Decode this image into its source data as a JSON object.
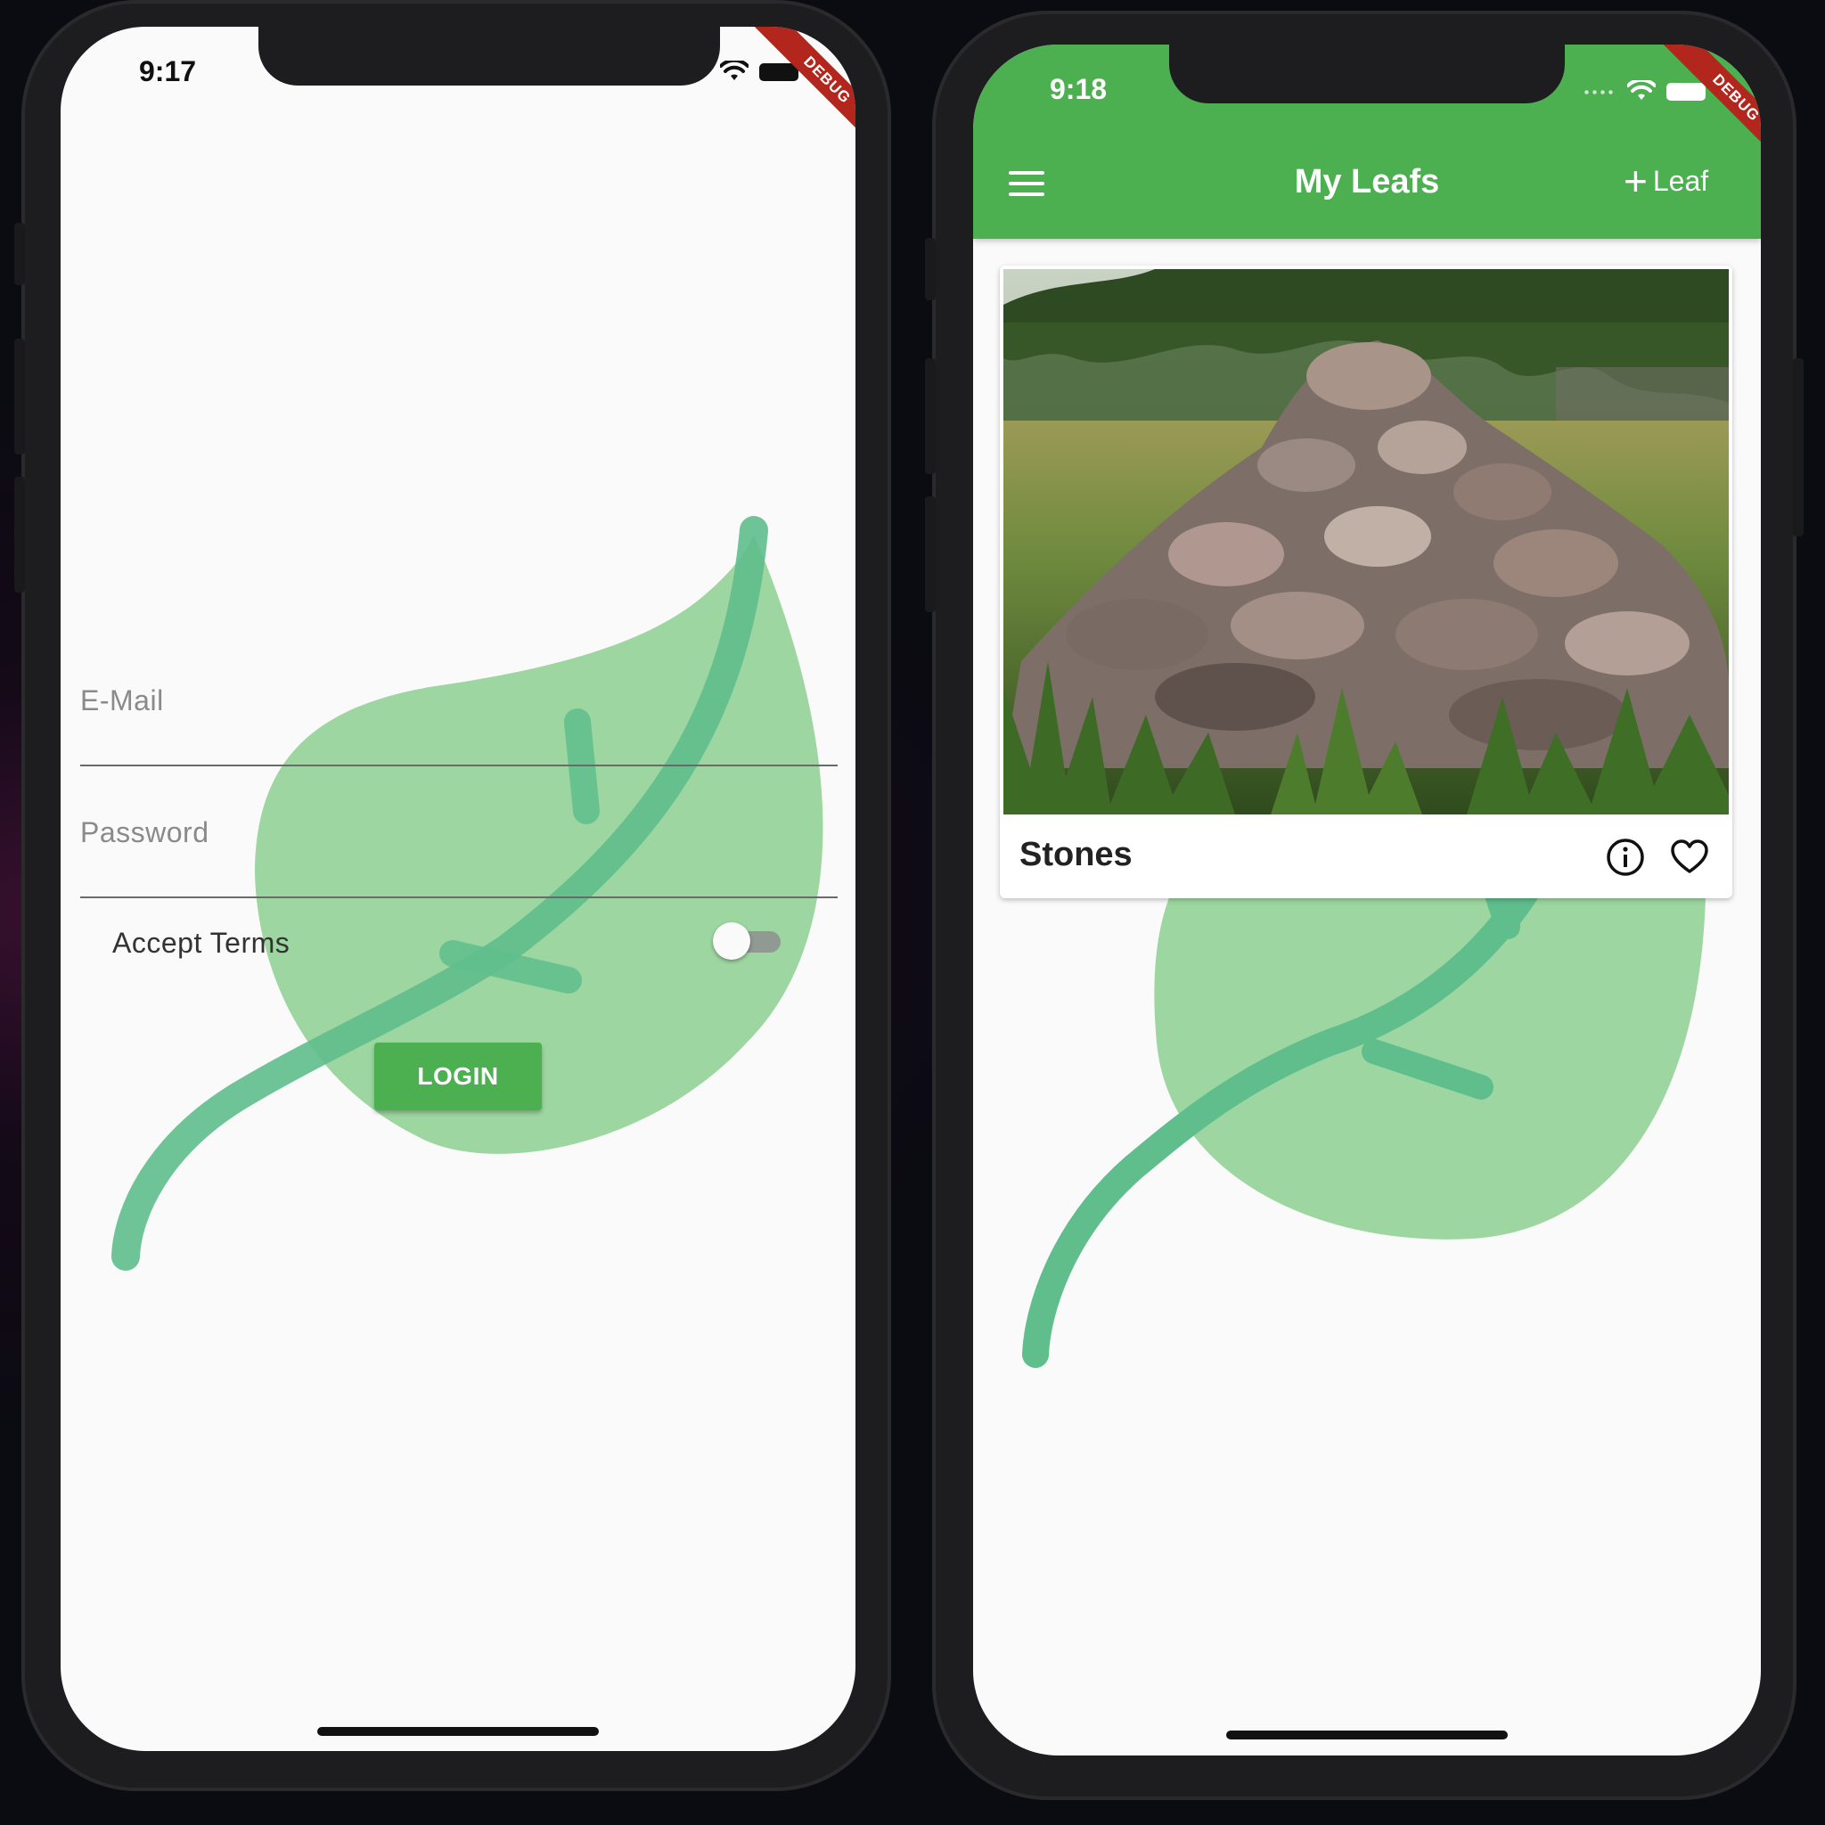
{
  "login_screen": {
    "status": {
      "time": "9:17"
    },
    "debug_banner": "DEBUG",
    "email_field": {
      "placeholder": "E-Mail"
    },
    "password_field": {
      "placeholder": "Password"
    },
    "accept_terms": {
      "label": "Accept Terms",
      "on": false
    },
    "login_button": {
      "label": "LOGIN"
    }
  },
  "list_screen": {
    "status": {
      "time": "9:18"
    },
    "debug_banner": "DEBUG",
    "appbar": {
      "title": "My Leafs",
      "menu_icon": "hamburger-menu-icon",
      "add_action_label": "Leaf"
    },
    "cards": [
      {
        "title": "Stones",
        "info_icon": "info-icon",
        "favorite_icon": "heart-outline-icon"
      }
    ]
  },
  "colors": {
    "primary": "#4caf50",
    "leaf_fill": "#9dd6a0",
    "leaf_vein": "#5fbe8c",
    "debug_red": "#b3261e"
  }
}
